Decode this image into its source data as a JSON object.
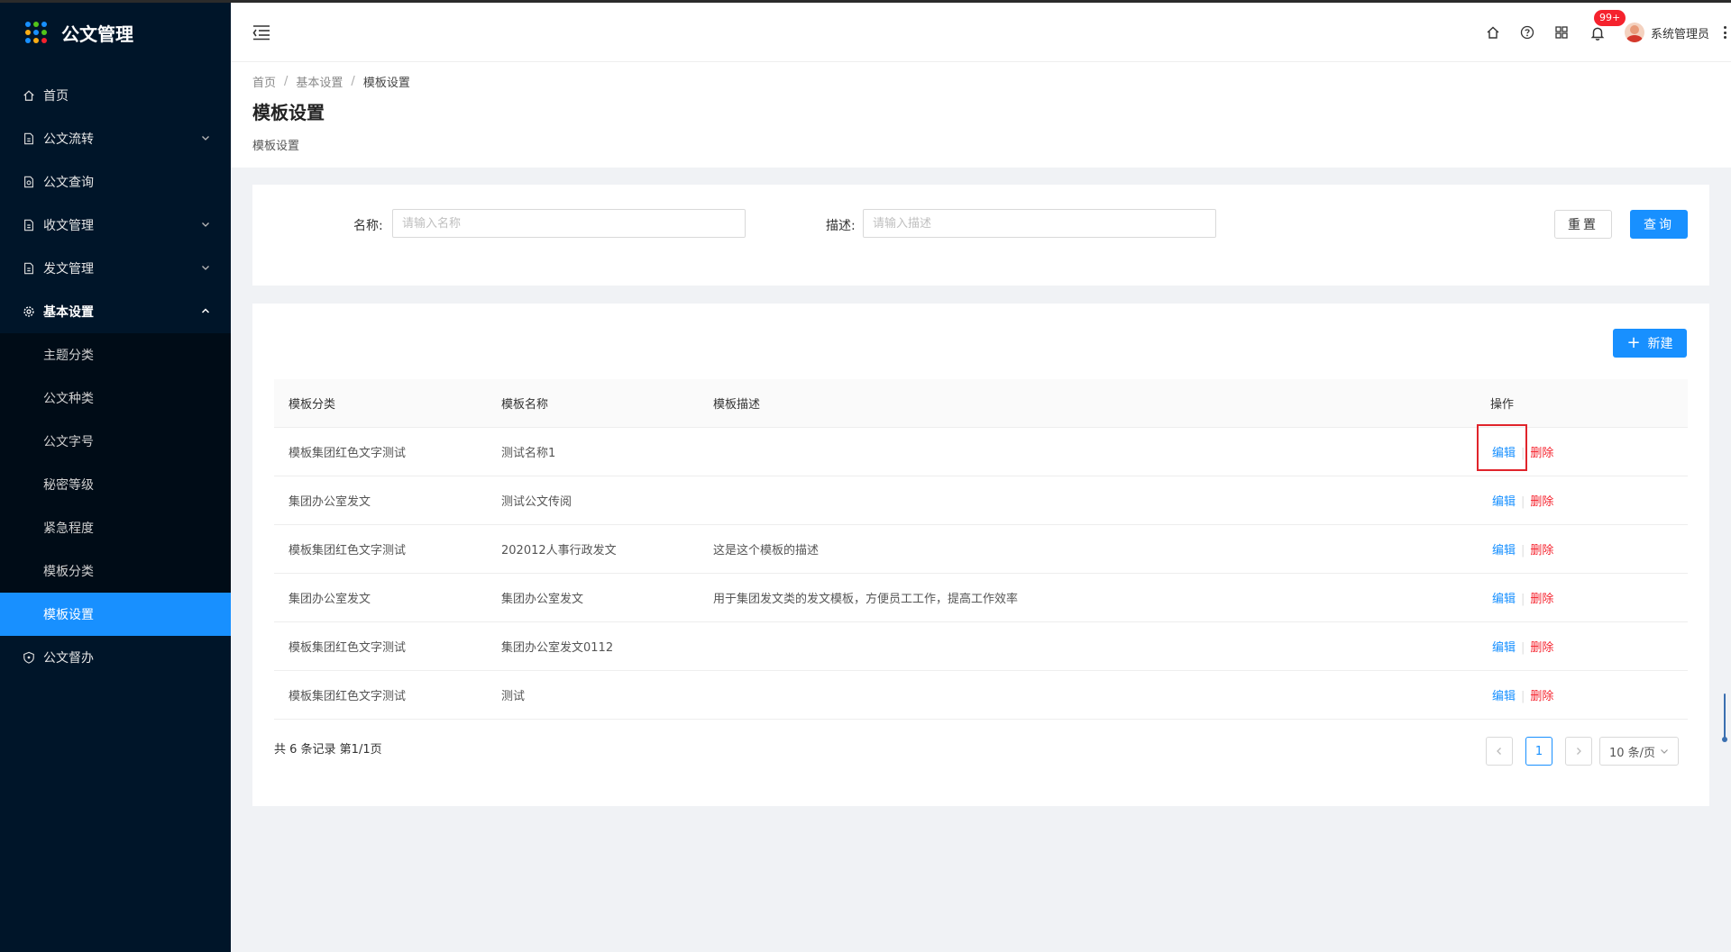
{
  "app": {
    "title": "公文管理"
  },
  "sidebar": {
    "items": [
      {
        "label": "首页",
        "icon": "home-icon"
      },
      {
        "label": "公文流转",
        "icon": "document-icon",
        "has_arrow": true
      },
      {
        "label": "公文查询",
        "icon": "document-search-icon"
      },
      {
        "label": "收文管理",
        "icon": "document-icon",
        "has_arrow": true
      },
      {
        "label": "发文管理",
        "icon": "document-icon",
        "has_arrow": true
      },
      {
        "label": "基本设置",
        "icon": "gear-icon",
        "open": true
      }
    ],
    "sub_items": [
      {
        "label": "主题分类"
      },
      {
        "label": "公文种类"
      },
      {
        "label": "公文字号"
      },
      {
        "label": "秘密等级"
      },
      {
        "label": "紧急程度"
      },
      {
        "label": "模板分类"
      },
      {
        "label": "模板设置",
        "active": true
      }
    ],
    "after_items": [
      {
        "label": "公文督办",
        "icon": "shield-icon"
      }
    ]
  },
  "header": {
    "notification_badge": "99+",
    "user_name": "系统管理员"
  },
  "breadcrumb": [
    "首页",
    "基本设置",
    "模板设置"
  ],
  "page": {
    "title": "模板设置",
    "subtitle": "模板设置"
  },
  "search": {
    "name_label": "名称:",
    "name_placeholder": "请输入名称",
    "desc_label": "描述:",
    "desc_placeholder": "请输入描述",
    "reset_label": "重置",
    "query_label": "查询"
  },
  "table": {
    "new_label": "新建",
    "columns": [
      "模板分类",
      "模板名称",
      "模板描述",
      "操作"
    ],
    "edit_label": "编辑",
    "delete_label": "删除",
    "rows": [
      {
        "category": "模板集团红色文字测试",
        "name": "测试名称1",
        "description": ""
      },
      {
        "category": "集团办公室发文",
        "name": "测试公文传阅",
        "description": ""
      },
      {
        "category": "模板集团红色文字测试",
        "name": "202012人事行政发文",
        "description": "这是这个模板的描述"
      },
      {
        "category": "集团办公室发文",
        "name": "集团办公室发文",
        "description": "用于集团发文类的发文模板，方便员工工作，提高工作效率"
      },
      {
        "category": "模板集团红色文字测试",
        "name": "集团办公室发文0112",
        "description": ""
      },
      {
        "category": "模板集团红色文字测试",
        "name": "测试",
        "description": ""
      }
    ]
  },
  "pagination": {
    "summary": "共 6 条记录 第1/1页",
    "current_page": "1",
    "page_size": "10 条/页"
  },
  "colors": {
    "sidebar_bg": "#001529",
    "accent": "#1890ff",
    "danger": "#f5222d",
    "highlight_border": "#e0242b"
  }
}
